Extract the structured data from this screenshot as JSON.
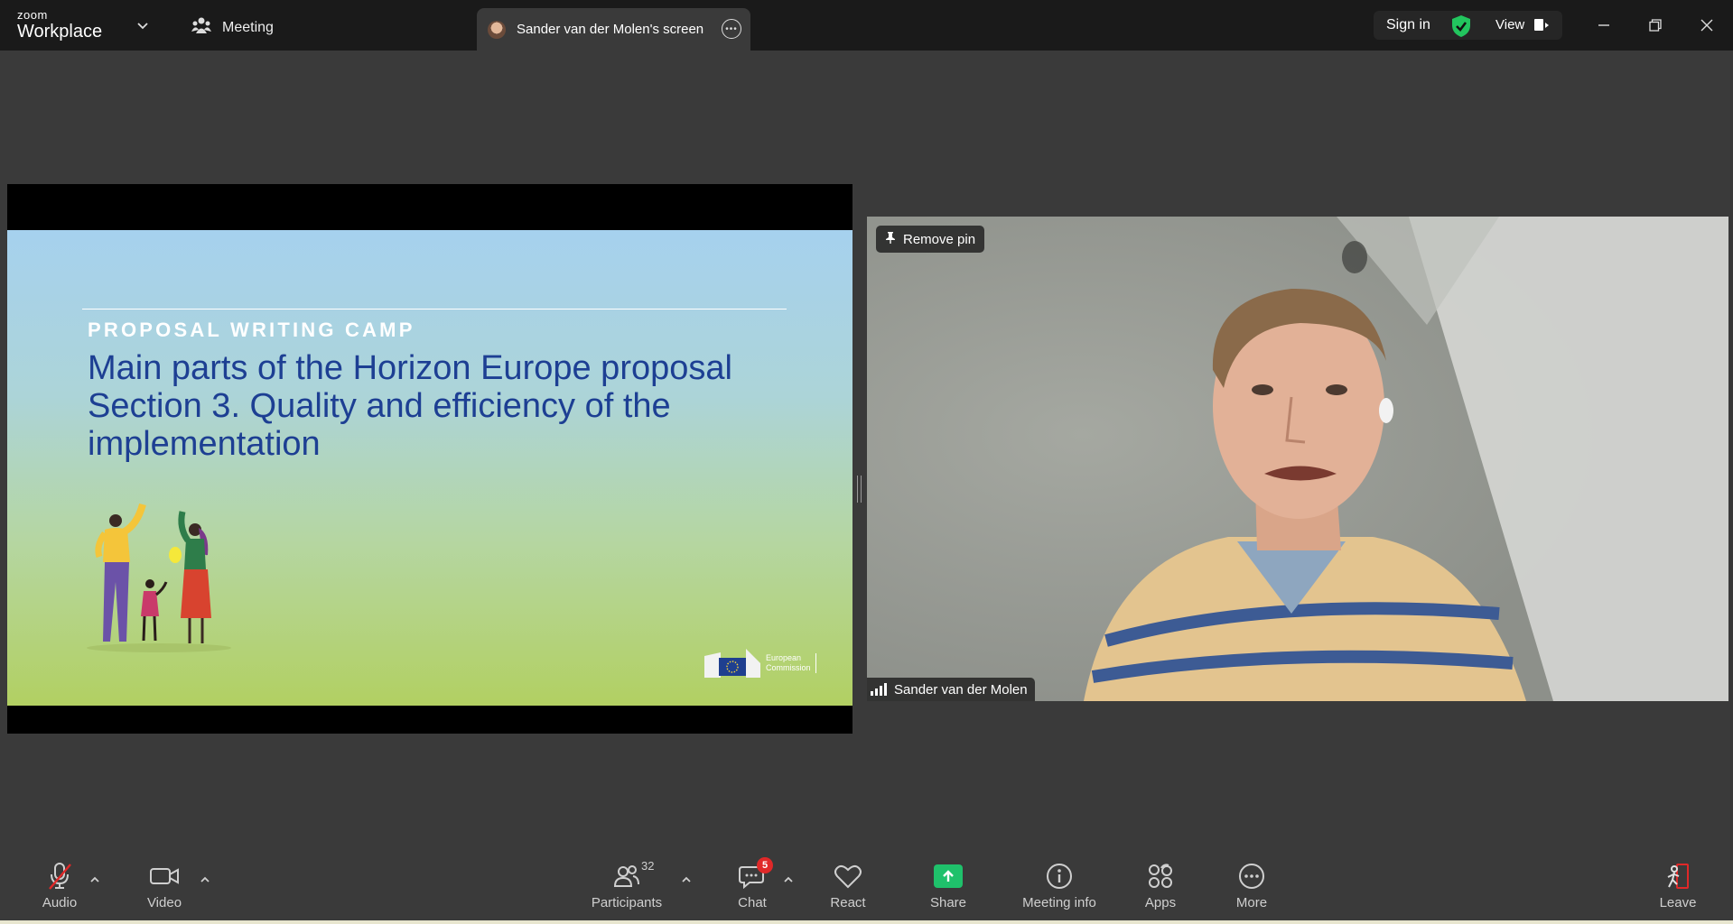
{
  "titlebar": {
    "logo_small": "zoom",
    "logo_large": "Workplace",
    "meeting_label": "Meeting",
    "active_tab_label": "Sander van der Molen's screen",
    "sign_in": "Sign in",
    "view": "View"
  },
  "slide": {
    "kicker": "PROPOSAL WRITING CAMP",
    "title_line1": "Main parts of the Horizon Europe proposal",
    "title_line2": "Section 3. Quality and efficiency of the",
    "title_line3": "implementation",
    "logo_text_1": "European",
    "logo_text_2": "Commission"
  },
  "video": {
    "pin_label": "Remove pin",
    "participant_name": "Sander van der Molen"
  },
  "toolbar": {
    "audio": "Audio",
    "video": "Video",
    "participants": "Participants",
    "participants_count": "32",
    "chat": "Chat",
    "chat_badge": "5",
    "react": "React",
    "share": "Share",
    "meeting_info": "Meeting info",
    "apps": "Apps",
    "more": "More",
    "leave": "Leave"
  },
  "colors": {
    "titlebar_bg": "#1a1a1a",
    "main_bg": "#3a3a3a",
    "share_green": "#1fc16b",
    "badge_red": "#e02828",
    "slide_title_blue": "#1d3f93",
    "shield_green": "#22c55e"
  }
}
